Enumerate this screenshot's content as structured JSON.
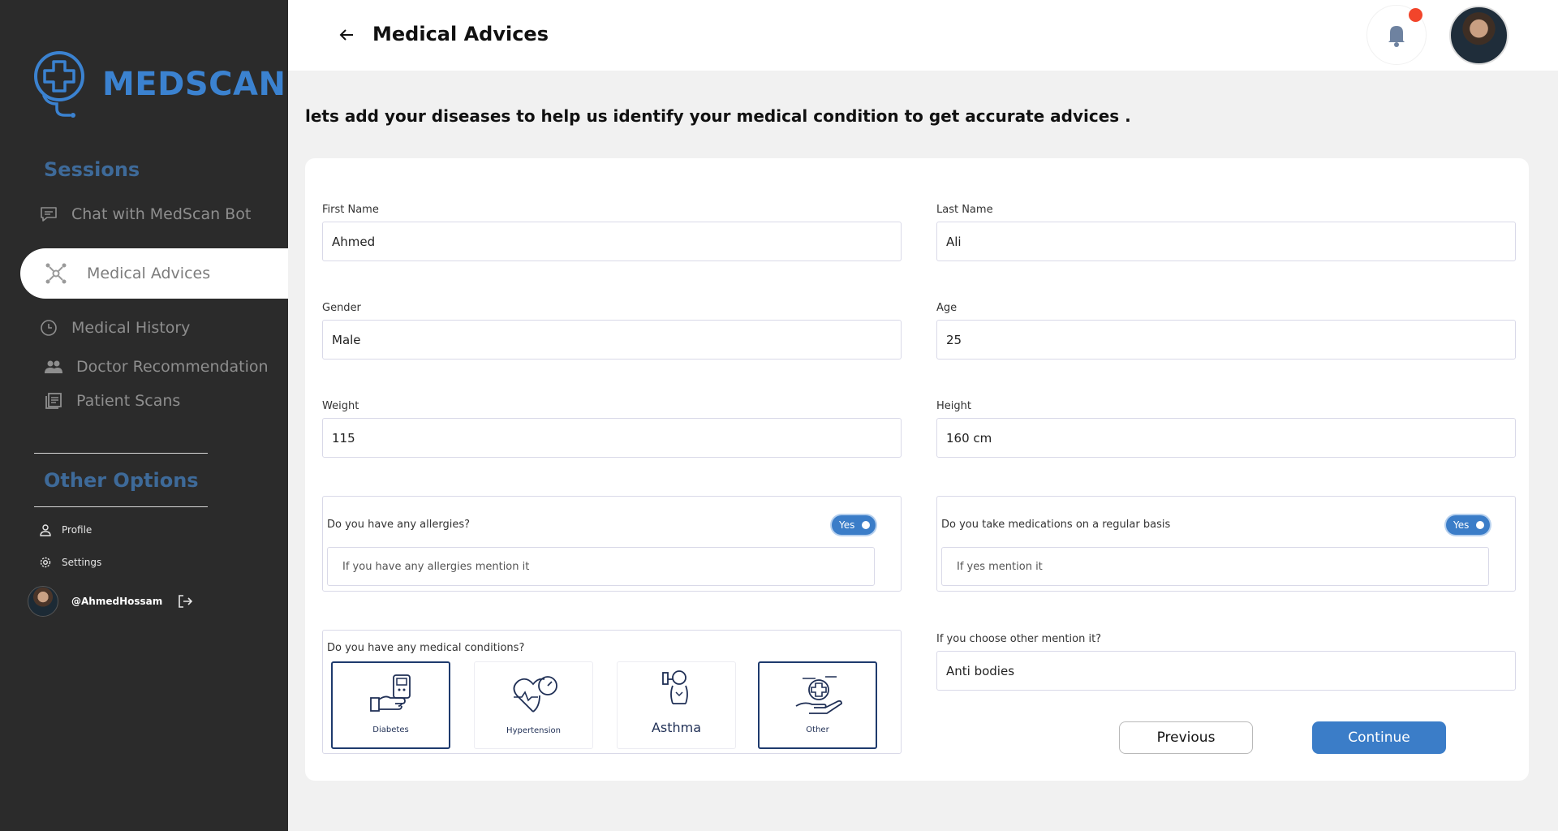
{
  "app": {
    "name": "MEDSCAN"
  },
  "sidebar": {
    "sessions_title": "Sessions",
    "sessions": [
      {
        "label": "Chat with MedScan Bot",
        "icon": "chat-icon"
      },
      {
        "label": "Medical Advices",
        "icon": "network-icon",
        "active": true
      },
      {
        "label": "Medical History",
        "icon": "clock-icon"
      },
      {
        "label": "Doctor Recommendation",
        "icon": "people-icon"
      },
      {
        "label": "Patient Scans",
        "icon": "documents-icon"
      }
    ],
    "other_title": "Other Options",
    "other": [
      {
        "label": "Profile",
        "icon": "user-icon"
      },
      {
        "label": "Settings",
        "icon": "gear-icon"
      }
    ],
    "user": {
      "handle": "@AhmedHossam"
    }
  },
  "header": {
    "title": "Medical Advices"
  },
  "intro": "lets add your diseases to help us identify your medical condition to get accurate advices .",
  "form": {
    "first_name": {
      "label": "First Name",
      "value": "Ahmed"
    },
    "last_name": {
      "label": "Last Name",
      "value": "Ali"
    },
    "gender": {
      "label": "Gender",
      "value": "Male"
    },
    "age": {
      "label": "Age",
      "value": "25"
    },
    "weight": {
      "label": "Weight",
      "value": "115"
    },
    "height": {
      "label": "Height",
      "value": "160 cm"
    },
    "allergies": {
      "question": "Do you have any allergies?",
      "toggle": "Yes",
      "placeholder": "If you have any allergies mention it"
    },
    "medications": {
      "question": "Do you take medications on a regular basis",
      "toggle": "Yes",
      "placeholder": "If yes mention it"
    },
    "conditions": {
      "question": "Do you have any medical conditions?",
      "options": [
        {
          "label": "Diabetes",
          "selected": true
        },
        {
          "label": "Hypertension",
          "selected": false
        },
        {
          "label": "Asthma",
          "selected": false
        },
        {
          "label": "Other",
          "selected": true
        }
      ]
    },
    "other_condition": {
      "label": "If you choose other mention it?",
      "value": "Anti bodies"
    }
  },
  "buttons": {
    "previous": "Previous",
    "continue": "Continue"
  },
  "colors": {
    "accent": "#3b7dc8",
    "sidebar_bg": "#2b2b2b",
    "notification": "#f2452b"
  }
}
